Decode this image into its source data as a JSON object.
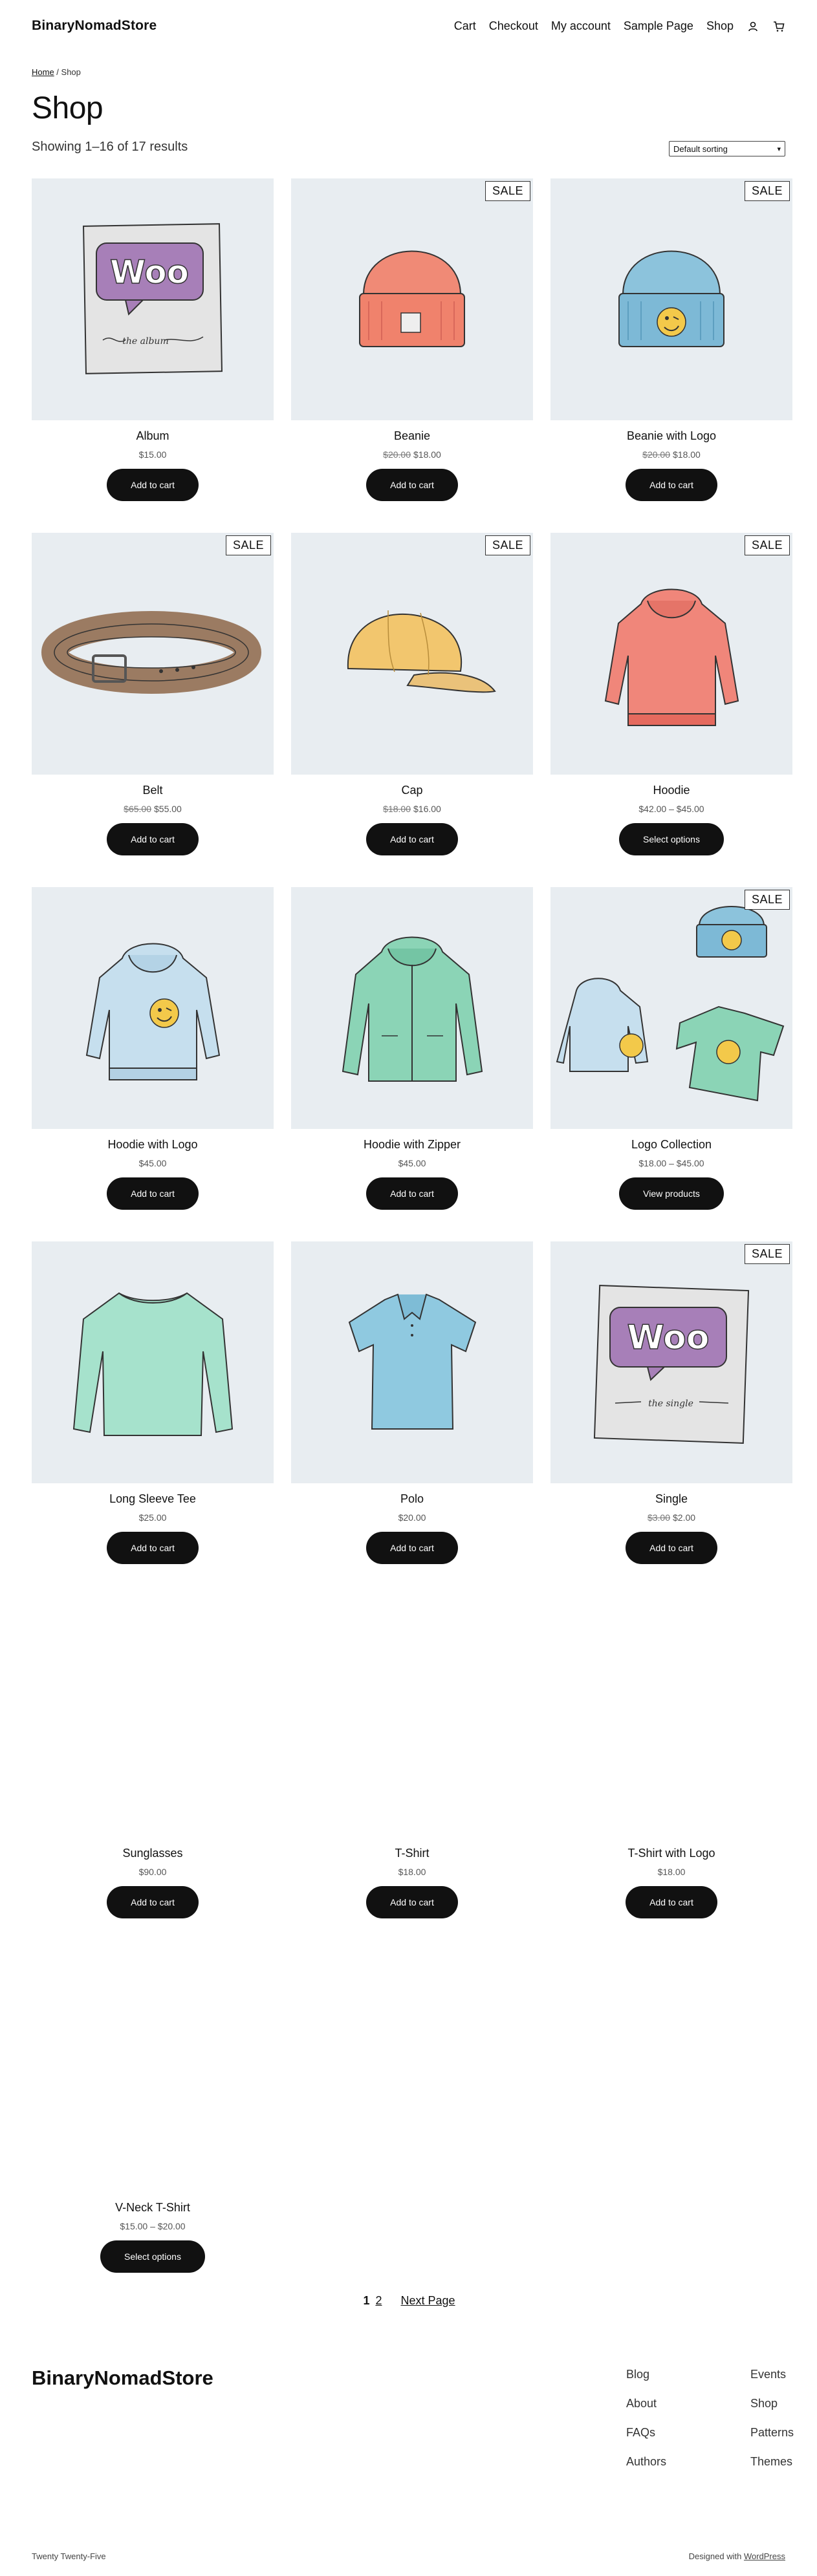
{
  "header": {
    "site_title": "BinaryNomadStore",
    "nav": [
      "Cart",
      "Checkout",
      "My account",
      "Sample Page",
      "Shop"
    ]
  },
  "breadcrumb": {
    "home": "Home",
    "separator": " / ",
    "current": "Shop"
  },
  "page_title": "Shop",
  "result_count": "Showing 1–16 of 17 results",
  "ordering": {
    "selected": "Default sorting"
  },
  "sale_label": "SALE",
  "products": [
    {
      "name": "Album",
      "price": "$15.00",
      "old_price": "",
      "button": "Add to cart",
      "sale": false,
      "art": "album"
    },
    {
      "name": "Beanie",
      "price": "$18.00",
      "old_price": "$20.00",
      "button": "Add to cart",
      "sale": true,
      "art": "beanie"
    },
    {
      "name": "Beanie with Logo",
      "price": "$18.00",
      "old_price": "$20.00",
      "button": "Add to cart",
      "sale": true,
      "art": "beanie-logo"
    },
    {
      "name": "Belt",
      "price": "$55.00",
      "old_price": "$65.00",
      "button": "Add to cart",
      "sale": true,
      "art": "belt"
    },
    {
      "name": "Cap",
      "price": "$16.00",
      "old_price": "$18.00",
      "button": "Add to cart",
      "sale": true,
      "art": "cap"
    },
    {
      "name": "Hoodie",
      "price": "$42.00 – $45.00",
      "old_price": "",
      "button": "Select options",
      "sale": true,
      "art": "hoodie"
    },
    {
      "name": "Hoodie with Logo",
      "price": "$45.00",
      "old_price": "",
      "button": "Add to cart",
      "sale": false,
      "art": "hoodie-logo"
    },
    {
      "name": "Hoodie with Zipper",
      "price": "$45.00",
      "old_price": "",
      "button": "Add to cart",
      "sale": false,
      "art": "hoodie-zip"
    },
    {
      "name": "Logo Collection",
      "price": "$18.00 – $45.00",
      "old_price": "",
      "button": "View products",
      "sale": true,
      "art": "collection"
    },
    {
      "name": "Long Sleeve Tee",
      "price": "$25.00",
      "old_price": "",
      "button": "Add to cart",
      "sale": false,
      "art": "longsleeve"
    },
    {
      "name": "Polo",
      "price": "$20.00",
      "old_price": "",
      "button": "Add to cart",
      "sale": false,
      "art": "polo"
    },
    {
      "name": "Single",
      "price": "$2.00",
      "old_price": "$3.00",
      "button": "Add to cart",
      "sale": true,
      "art": "single"
    },
    {
      "name": "Sunglasses",
      "price": "$90.00",
      "old_price": "",
      "button": "Add to cart",
      "sale": false,
      "art": "blank"
    },
    {
      "name": "T-Shirt",
      "price": "$18.00",
      "old_price": "",
      "button": "Add to cart",
      "sale": false,
      "art": "blank"
    },
    {
      "name": "T-Shirt with Logo",
      "price": "$18.00",
      "old_price": "",
      "button": "Add to cart",
      "sale": false,
      "art": "blank"
    },
    {
      "name": "V-Neck T-Shirt",
      "price": "$15.00 – $20.00",
      "old_price": "",
      "button": "Select options",
      "sale": false,
      "art": "blank"
    }
  ],
  "pagination": {
    "pages": [
      "1",
      "2"
    ],
    "next": "Next Page"
  },
  "footer": {
    "title": "BinaryNomadStore",
    "col1": [
      "Blog",
      "About",
      "FAQs",
      "Authors"
    ],
    "col2": [
      "Events",
      "Shop",
      "Patterns",
      "Themes"
    ],
    "theme": "Twenty Twenty-Five",
    "designed_prefix": "Designed with ",
    "designed_link": "WordPress"
  },
  "icons": {
    "account": "user-icon",
    "cart": "cart-icon"
  }
}
